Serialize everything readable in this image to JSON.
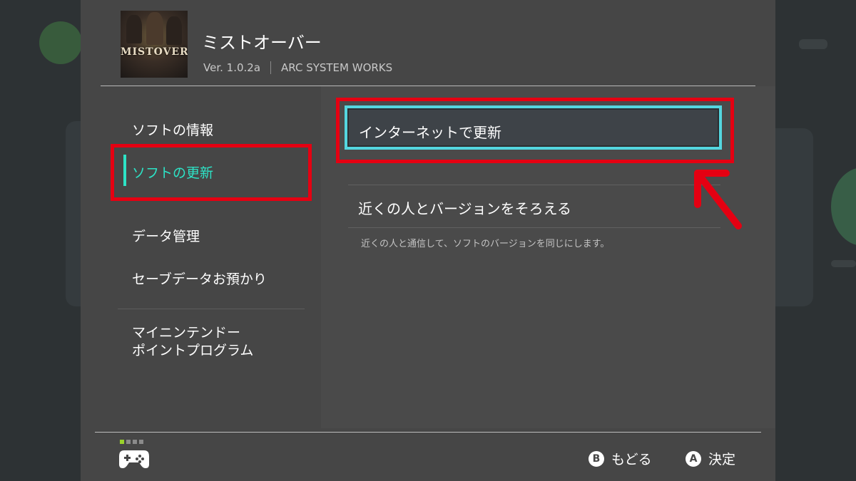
{
  "header": {
    "game_title": "ミストオーバー",
    "version": "Ver. 1.0.2a",
    "publisher": "ARC SYSTEM WORKS",
    "thumbnail_text": "MISTOVER"
  },
  "sidebar": {
    "items": [
      {
        "label": "ソフトの情報"
      },
      {
        "label": "ソフトの更新",
        "active": true
      },
      {
        "label": "データ管理"
      },
      {
        "label": "セーブデータお預かり"
      },
      {
        "label_line1": "マイニンテンドー",
        "label_line2": "ポイントプログラム"
      }
    ]
  },
  "content": {
    "internet_update_label": "インターネットで更新",
    "local_update_label": "近くの人とバージョンをそろえる",
    "local_update_desc": "近くの人と通信して、ソフトのバージョンを同じにします。"
  },
  "footer": {
    "back_key": "B",
    "back_label": "もどる",
    "ok_key": "A",
    "ok_label": "決定"
  },
  "colors": {
    "accent": "#2de3c6",
    "focus_border": "#54d6df",
    "annotation_red": "#e50012",
    "controller_active": "#9ad22b"
  }
}
